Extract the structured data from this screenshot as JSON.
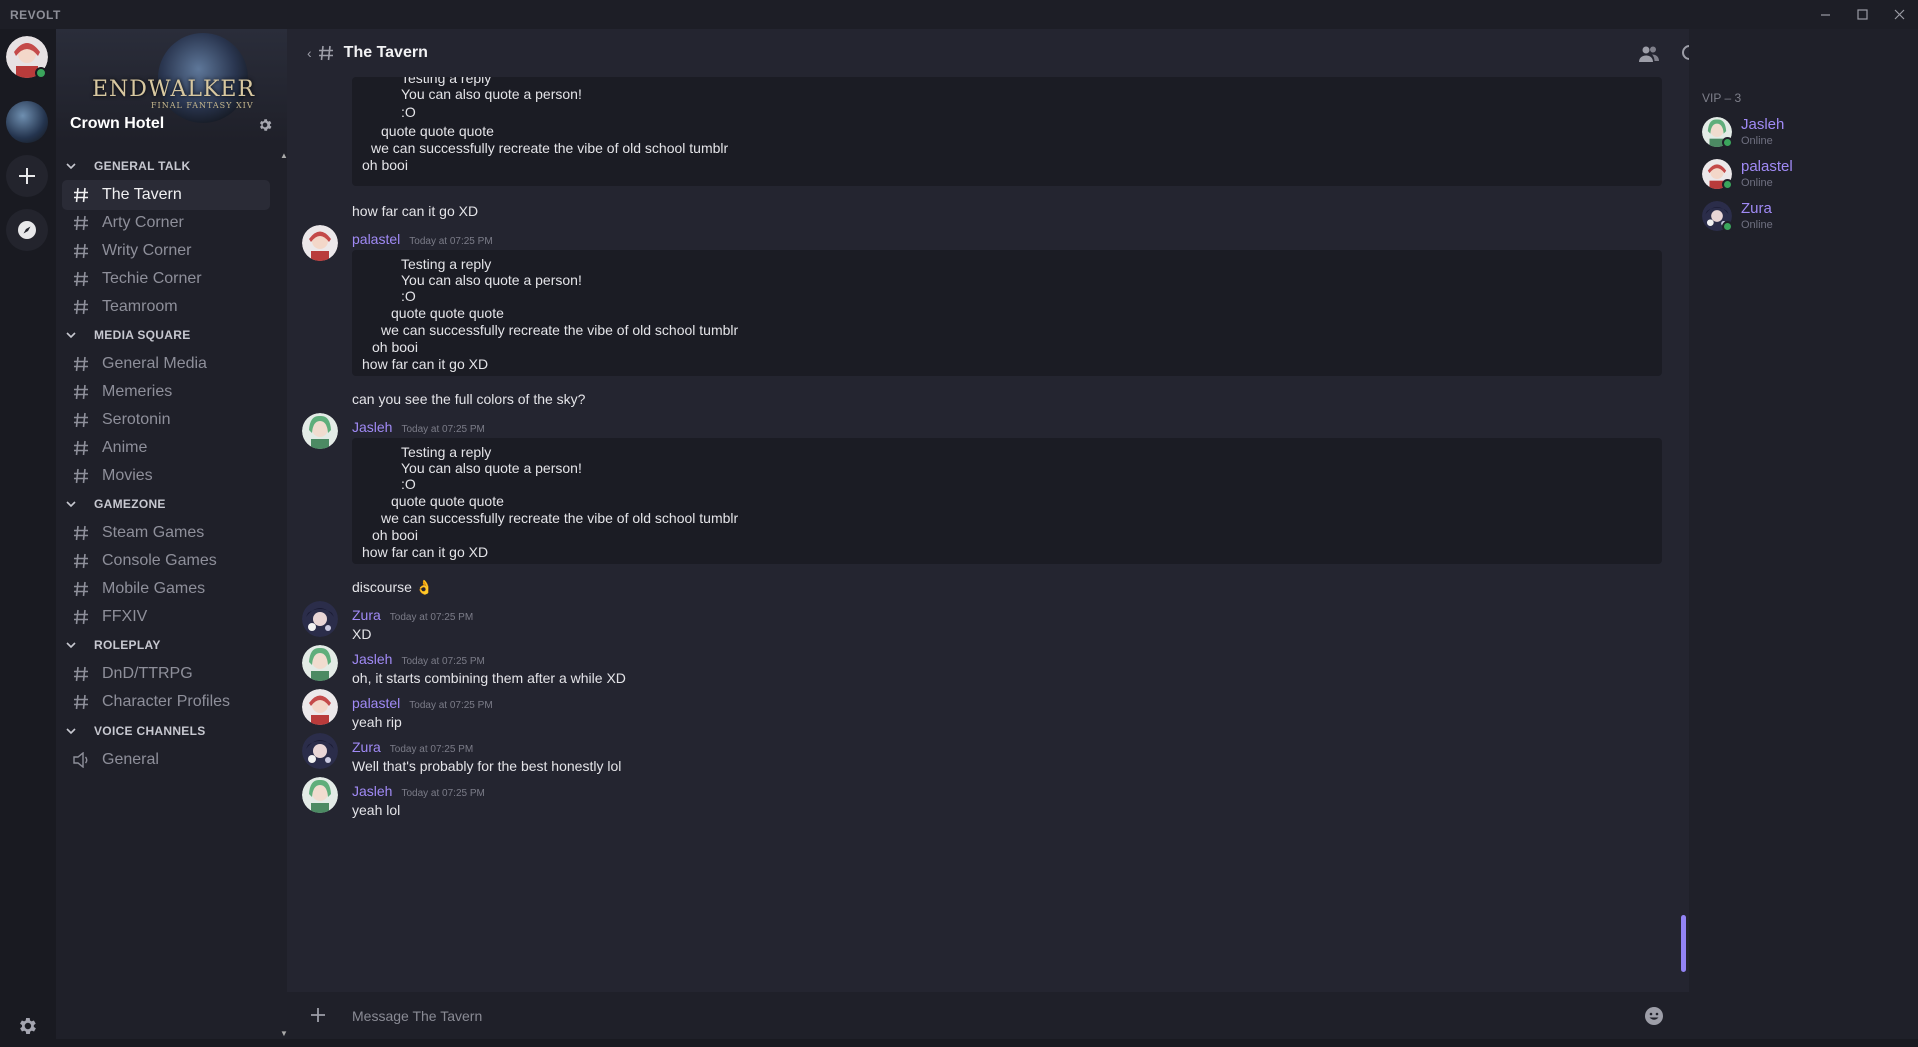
{
  "app": {
    "title": "REVOLT"
  },
  "server": {
    "name": "Crown Hotel",
    "banner_logo": "ENDWALKER",
    "banner_sub": "FINAL FANTASY XIV"
  },
  "categories": [
    {
      "name": "GENERAL TALK",
      "channels": [
        "The Tavern",
        "Arty Corner",
        "Writy Corner",
        "Techie Corner",
        "Teamroom"
      ]
    },
    {
      "name": "MEDIA SQUARE",
      "channels": [
        "General Media",
        "Memeries",
        "Serotonin",
        "Anime",
        "Movies"
      ]
    },
    {
      "name": "GAMEZONE",
      "channels": [
        "Steam Games",
        "Console Games",
        "Mobile Games",
        "FFXIV"
      ]
    },
    {
      "name": "ROLEPLAY",
      "channels": [
        "DnD/TTRPG",
        "Character Profiles"
      ]
    },
    {
      "name": "VOICE CHANNELS",
      "channels": [
        "General"
      ]
    }
  ],
  "active_channel": "The Tavern",
  "chat": {
    "channel_title": "The Tavern",
    "composer_placeholder": "Message The Tavern",
    "top_quote": [
      "Testing a reply",
      "You can also quote a person!",
      ":O",
      "quote quote quote",
      "we can successfully recreate the vibe of old school tumblr",
      "oh booi"
    ],
    "messages": [
      {
        "kind": "cont",
        "text": "how far can it go XD"
      },
      {
        "kind": "quote",
        "user": "palastel",
        "time": "Today at 07:25 PM",
        "lines": [
          "Testing a reply",
          "You can also quote a person!",
          ":O",
          "quote quote quote",
          "we can successfully recreate the vibe of old school tumblr",
          "oh booi",
          "how far can it go XD"
        ]
      },
      {
        "kind": "cont",
        "text": "can you see the full colors of the sky?"
      },
      {
        "kind": "quote",
        "user": "Jasleh",
        "time": "Today at 07:25 PM",
        "lines": [
          "Testing a reply",
          "You can also quote a person!",
          ":O",
          "quote quote quote",
          "we can successfully recreate the vibe of old school tumblr",
          "oh booi",
          "how far can it go XD"
        ]
      },
      {
        "kind": "cont",
        "text": "discourse 👌"
      },
      {
        "kind": "msg",
        "user": "Zura",
        "time": "Today at 07:25 PM",
        "text": "XD"
      },
      {
        "kind": "msg",
        "user": "Jasleh",
        "time": "Today at 07:25 PM",
        "text": "oh, it starts combining them after a while XD"
      },
      {
        "kind": "msg",
        "user": "palastel",
        "time": "Today at 07:25 PM",
        "text": "yeah rip"
      },
      {
        "kind": "msg",
        "user": "Zura",
        "time": "Today at 07:25 PM",
        "text": "Well that's probably for the best honestly lol"
      },
      {
        "kind": "msg",
        "user": "Jasleh",
        "time": "Today at 07:25 PM",
        "text": "yeah lol"
      }
    ]
  },
  "members": {
    "category": "VIP – 3",
    "list": [
      {
        "name": "Jasleh",
        "status": "Online"
      },
      {
        "name": "palastel",
        "status": "Online"
      },
      {
        "name": "Zura",
        "status": "Online"
      }
    ]
  },
  "colors": {
    "accent": "#a08af5",
    "online": "#3ba55c",
    "bg": "#242530",
    "sidebar": "#1f2029"
  }
}
